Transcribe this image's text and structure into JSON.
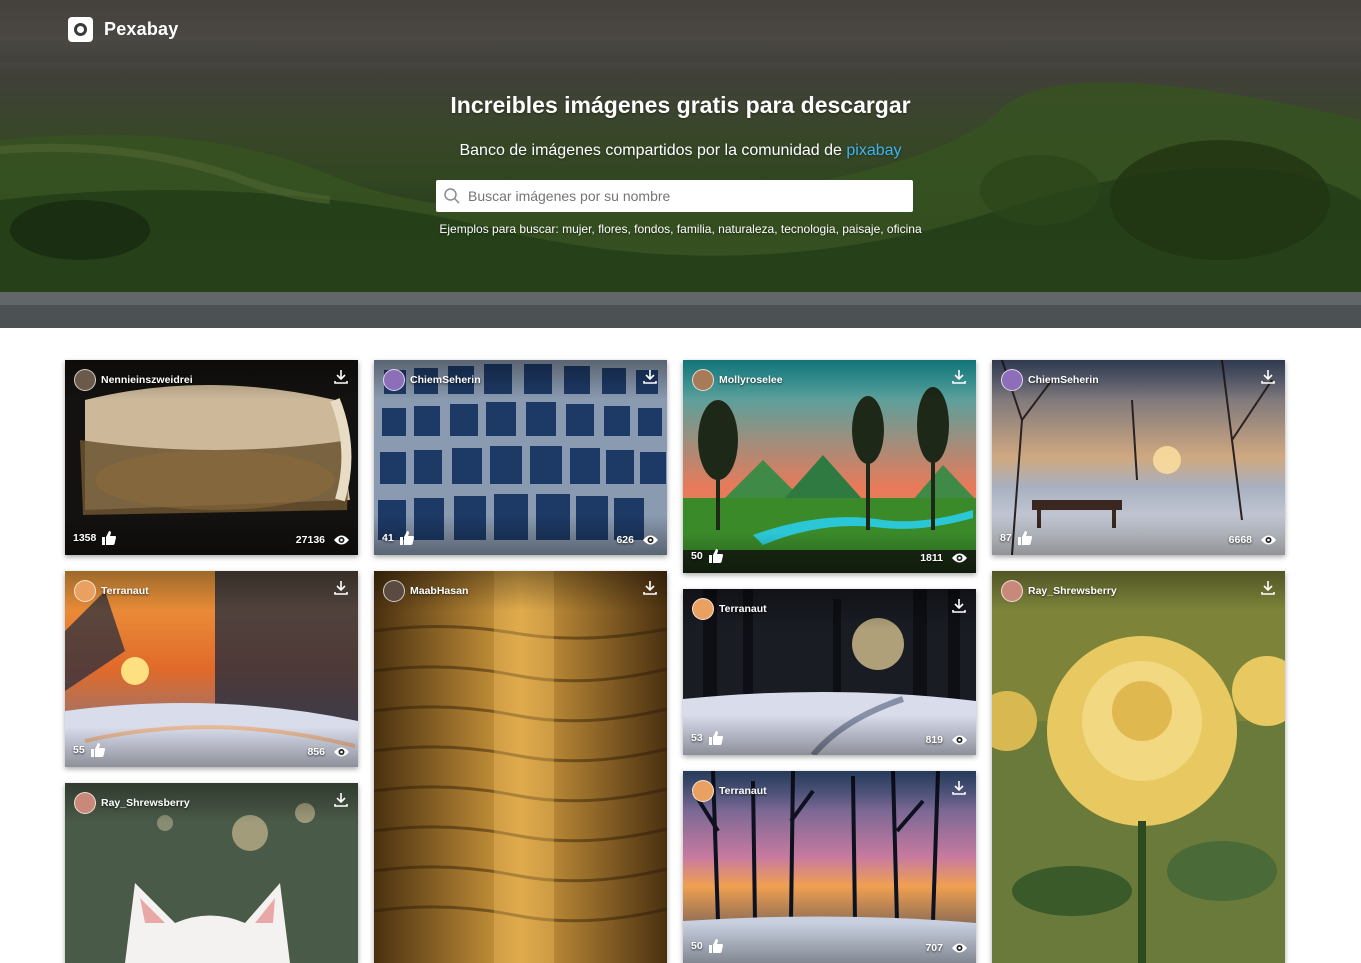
{
  "brand": {
    "name": "Pexabay",
    "icon": "camera-icon"
  },
  "hero": {
    "title": "Increibles imágenes gratis para descargar",
    "subtitle_prefix": "Banco de imágenes compartidos por la comunidad de ",
    "subtitle_link": "pixabay",
    "examples": "Ejemplos para buscar: mujer, flores, fondos, familia, naturaleza, tecnologia, paisaje, oficina"
  },
  "search": {
    "placeholder": "Buscar imágenes por su nombre",
    "value": ""
  },
  "colors": {
    "link": "#41b2f0",
    "text_on_image": "#ffffff"
  },
  "cards": [
    {
      "user": "Nennieinszweidrei",
      "likes": "1358",
      "views": "27136"
    },
    {
      "user": "ChiemSeherin",
      "likes": "41",
      "views": "626"
    },
    {
      "user": "Mollyroselee",
      "likes": "50",
      "views": "1811"
    },
    {
      "user": "ChiemSeherin",
      "likes": "87",
      "views": "6668"
    },
    {
      "user": "Terranaut",
      "likes": "55",
      "views": "856"
    },
    {
      "user": "MaabHasan",
      "likes": "",
      "views": ""
    },
    {
      "user": "Terranaut",
      "likes": "53",
      "views": "819"
    },
    {
      "user": "Ray_Shrewsberry",
      "likes": "",
      "views": ""
    },
    {
      "user": "Ray_Shrewsberry",
      "likes": "",
      "views": ""
    },
    {
      "user": "Terranaut",
      "likes": "50",
      "views": "707"
    }
  ]
}
